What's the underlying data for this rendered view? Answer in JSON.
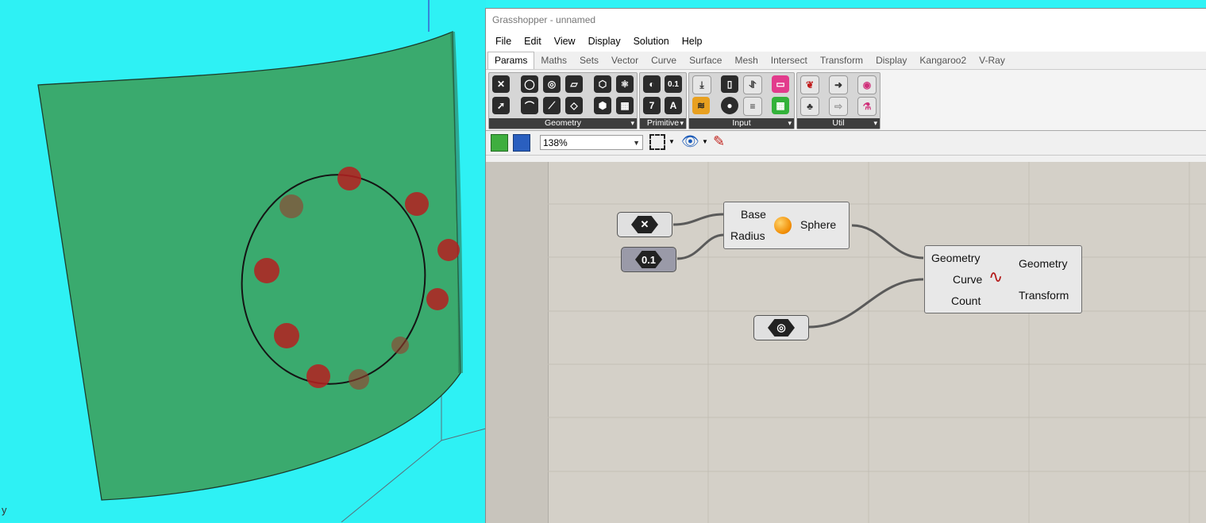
{
  "viewport": {
    "axis_label": "y"
  },
  "window": {
    "title": "Grasshopper - unnamed"
  },
  "menu": [
    "File",
    "Edit",
    "View",
    "Display",
    "Solution",
    "Help"
  ],
  "tabs": [
    "Params",
    "Maths",
    "Sets",
    "Vector",
    "Curve",
    "Surface",
    "Mesh",
    "Intersect",
    "Transform",
    "Display",
    "Kangaroo2",
    "V-Ray"
  ],
  "active_tab": "Params",
  "panels": {
    "geometry": "Geometry",
    "primitive": "Primitive",
    "input": "Input",
    "util": "Util"
  },
  "primitive_icons": {
    "number": "0.1",
    "integer": "7",
    "text": "A"
  },
  "zoom": "138%",
  "nodes": {
    "point_param": {
      "icon": "point-param-icon"
    },
    "number_param": {
      "label": "0.1"
    },
    "sphere": {
      "input1": "Base",
      "input2": "Radius",
      "output": "Sphere"
    },
    "curve_param": {
      "icon": "curve-param-icon"
    },
    "array": {
      "input1": "Geometry",
      "input2": "Curve",
      "input3": "Count",
      "output1": "Geometry",
      "output2": "Transform"
    }
  },
  "colors": {
    "surface": "#3aaa6e",
    "viewport_bg": "#2ef1f4",
    "canvas": "#d4d0c8",
    "sphere_red": "#b52020"
  }
}
